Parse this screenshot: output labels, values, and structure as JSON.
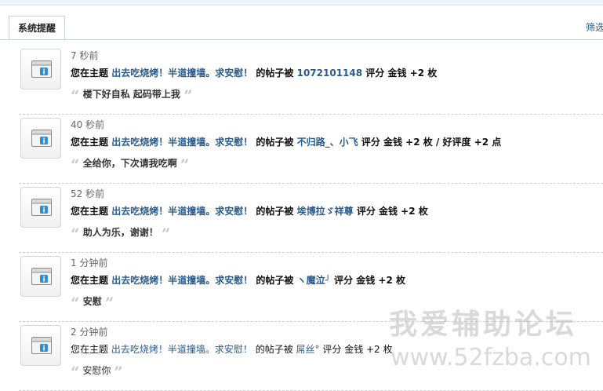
{
  "tabs": {
    "active": "系统提醒"
  },
  "filter_label": "筛选",
  "notifications": [
    {
      "time": "7 秒前",
      "prefix": "您在主题",
      "topic": "出去吃烧烤！半道撞墙。求安慰！",
      "mid": "的帖子被",
      "user": "1072101148",
      "rating": "评分 金钱 +2 枚",
      "comment": "楼下好自私 起码带上我",
      "bold": true
    },
    {
      "time": "40 秒前",
      "prefix": "您在主题",
      "topic": "出去吃烧烤！半道撞墙。求安慰！",
      "mid": "的帖子被",
      "user": "不归路_、小飞",
      "rating": "评分 金钱 +2 枚 / 好评度 +2 点",
      "comment": "全给你，下次请我吃啊",
      "bold": true
    },
    {
      "time": "52 秒前",
      "prefix": "您在主题",
      "topic": "出去吃烧烤！半道撞墙。求安慰！",
      "mid": "的帖子被",
      "user": "埃博拉ゞ祥尊",
      "rating": "评分 金钱 +2 枚",
      "comment": "助人为乐，谢谢！",
      "bold": true
    },
    {
      "time": "1 分钟前",
      "prefix": "您在主题",
      "topic": "出去吃烧烤！半道撞墙。求安慰！",
      "mid": "的帖子被",
      "user": "ヽ魔泣╯",
      "rating": "评分 金钱 +2 枚",
      "comment": "安慰",
      "bold": true
    },
    {
      "time": "2 分钟前",
      "prefix": "您在主题",
      "topic": "出去吃烧烤！半道撞墙。求安慰！",
      "mid": "的帖子被",
      "user": "屌丝°",
      "rating": "评分 金钱 +2 枚",
      "comment": "安慰你",
      "bold": false
    }
  ],
  "icon": "system-notice-icon",
  "colors": {
    "link": "#2b5b8a",
    "border": "#c6d3de"
  },
  "watermark": {
    "text": "我爱辅助论坛",
    "url": "www.52fzba.com"
  }
}
